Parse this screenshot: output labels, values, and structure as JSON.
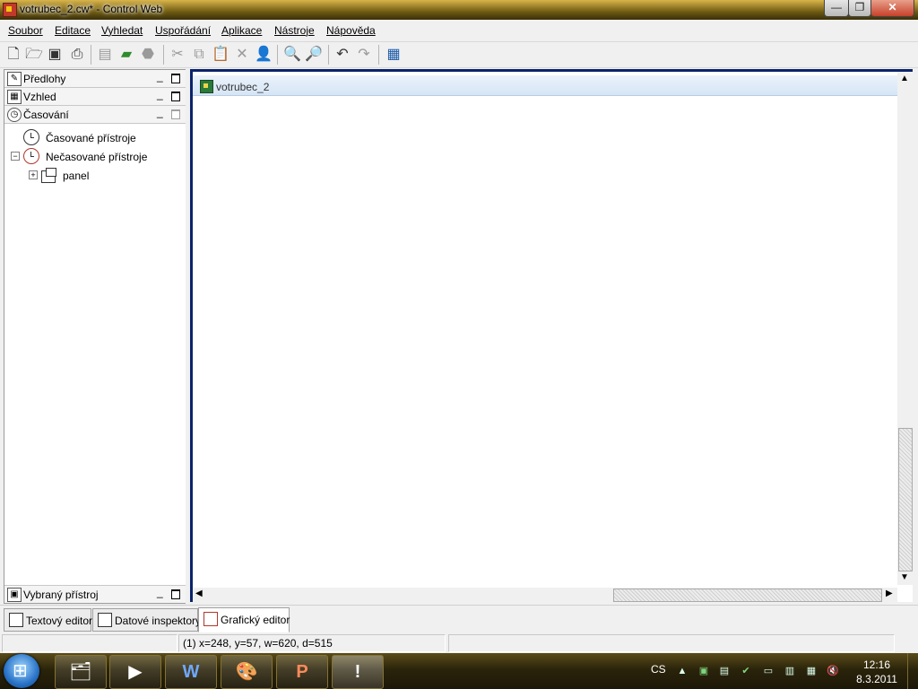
{
  "window": {
    "title": "votrubec_2.cw* - Control Web"
  },
  "menu": {
    "items": [
      "Soubor",
      "Editace",
      "Vyhledat",
      "Uspořádání",
      "Aplikace",
      "Nástroje",
      "Nápověda"
    ]
  },
  "toolbar": {
    "icons": [
      "new-icon",
      "open-icon",
      "save-icon",
      "print-icon",
      "compile-icon",
      "run-icon",
      "stop-icon",
      "cut-icon",
      "copy-icon",
      "paste-icon",
      "delete-icon",
      "user-icon",
      "zoom-in-icon",
      "zoom-out-icon",
      "undo-icon",
      "redo-icon",
      "properties-icon"
    ]
  },
  "left_panel": {
    "sections": {
      "predlohy": "Předlohy",
      "vzhled": "Vzhled",
      "casovani": "Časování",
      "vybrany": "Vybraný přístroj"
    },
    "tree": {
      "casovane": "Časované přístroje",
      "necasovane": "Nečasované přístroje",
      "panel": "panel"
    }
  },
  "editor": {
    "document_title": "votrubec_2"
  },
  "bottom_tabs": [
    "Textový editor",
    "Datové inspektory",
    "Grafický editor"
  ],
  "statusbar": {
    "info": "(1) x=248, y=57, w=620, d=515"
  },
  "taskbar": {
    "language": "CS",
    "time": "12:16",
    "date": "8.3.2011",
    "apps": [
      "explorer-icon",
      "media-player-icon",
      "word-icon",
      "paint-icon",
      "powerpoint-icon",
      "control-web-icon"
    ]
  }
}
